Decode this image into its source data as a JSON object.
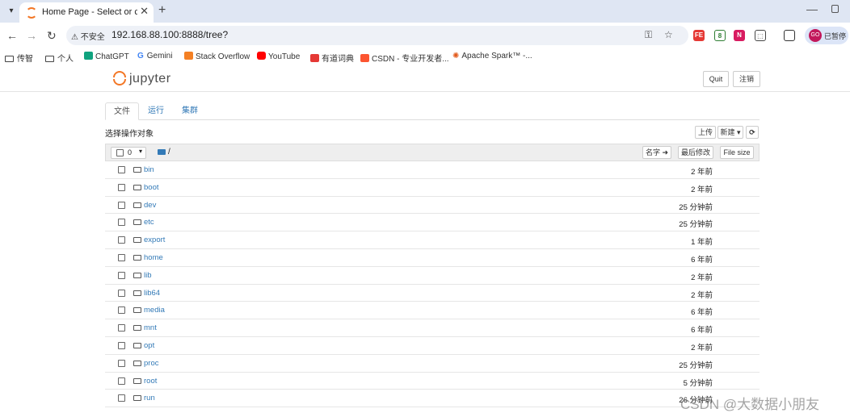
{
  "browser": {
    "tab_title": "Home Page - Select or create",
    "url": "192.168.88.100:8888/tree?",
    "security_label": "不安全",
    "profile_label": "已暂停",
    "profile_avatar": "GO"
  },
  "bookmarks": [
    {
      "label": "传智",
      "icon": "folder-icon"
    },
    {
      "label": "个人",
      "icon": "folder-icon"
    },
    {
      "label": "ChatGPT",
      "icon": "chatgpt-icon"
    },
    {
      "label": "Gemini",
      "icon": "google-icon"
    },
    {
      "label": "Stack Overflow",
      "icon": "stackoverflow-icon"
    },
    {
      "label": "YouTube",
      "icon": "youtube-icon"
    },
    {
      "label": "有道词典",
      "icon": "youdao-icon"
    },
    {
      "label": "CSDN - 专业开发者...",
      "icon": "csdn-icon"
    },
    {
      "label": "Apache Spark™ -...",
      "icon": "spark-icon"
    }
  ],
  "header": {
    "brand": "jupyter",
    "quit_label": "Quit",
    "logout_label": "注销"
  },
  "tabs": [
    {
      "label": "文件",
      "active": true
    },
    {
      "label": "运行",
      "active": false
    },
    {
      "label": "集群",
      "active": false
    }
  ],
  "toolbar": {
    "select_label": "选择操作对象",
    "upload_label": "上传",
    "new_label": "新建 ▾",
    "refresh_icon": "refresh-icon"
  },
  "list_header": {
    "selected_count": "0",
    "path": "/",
    "sort_name_label": "名字 ➜",
    "sort_modified_label": "最后修改",
    "sort_size_label": "File size"
  },
  "files": [
    {
      "name": "bin",
      "modified": "2 年前"
    },
    {
      "name": "boot",
      "modified": "2 年前"
    },
    {
      "name": "dev",
      "modified": "25 分钟前"
    },
    {
      "name": "etc",
      "modified": "25 分钟前"
    },
    {
      "name": "export",
      "modified": "1 年前"
    },
    {
      "name": "home",
      "modified": "6 年前"
    },
    {
      "name": "lib",
      "modified": "2 年前"
    },
    {
      "name": "lib64",
      "modified": "2 年前"
    },
    {
      "name": "media",
      "modified": "6 年前"
    },
    {
      "name": "mnt",
      "modified": "6 年前"
    },
    {
      "name": "opt",
      "modified": "2 年前"
    },
    {
      "name": "proc",
      "modified": "25 分钟前"
    },
    {
      "name": "root",
      "modified": "5 分钟前"
    },
    {
      "name": "run",
      "modified": "26 分钟前"
    }
  ],
  "watermark": "CSDN @大数据小朋友",
  "colors": {
    "jupyter_orange": "#f37726",
    "link_blue": "#337ab7"
  }
}
